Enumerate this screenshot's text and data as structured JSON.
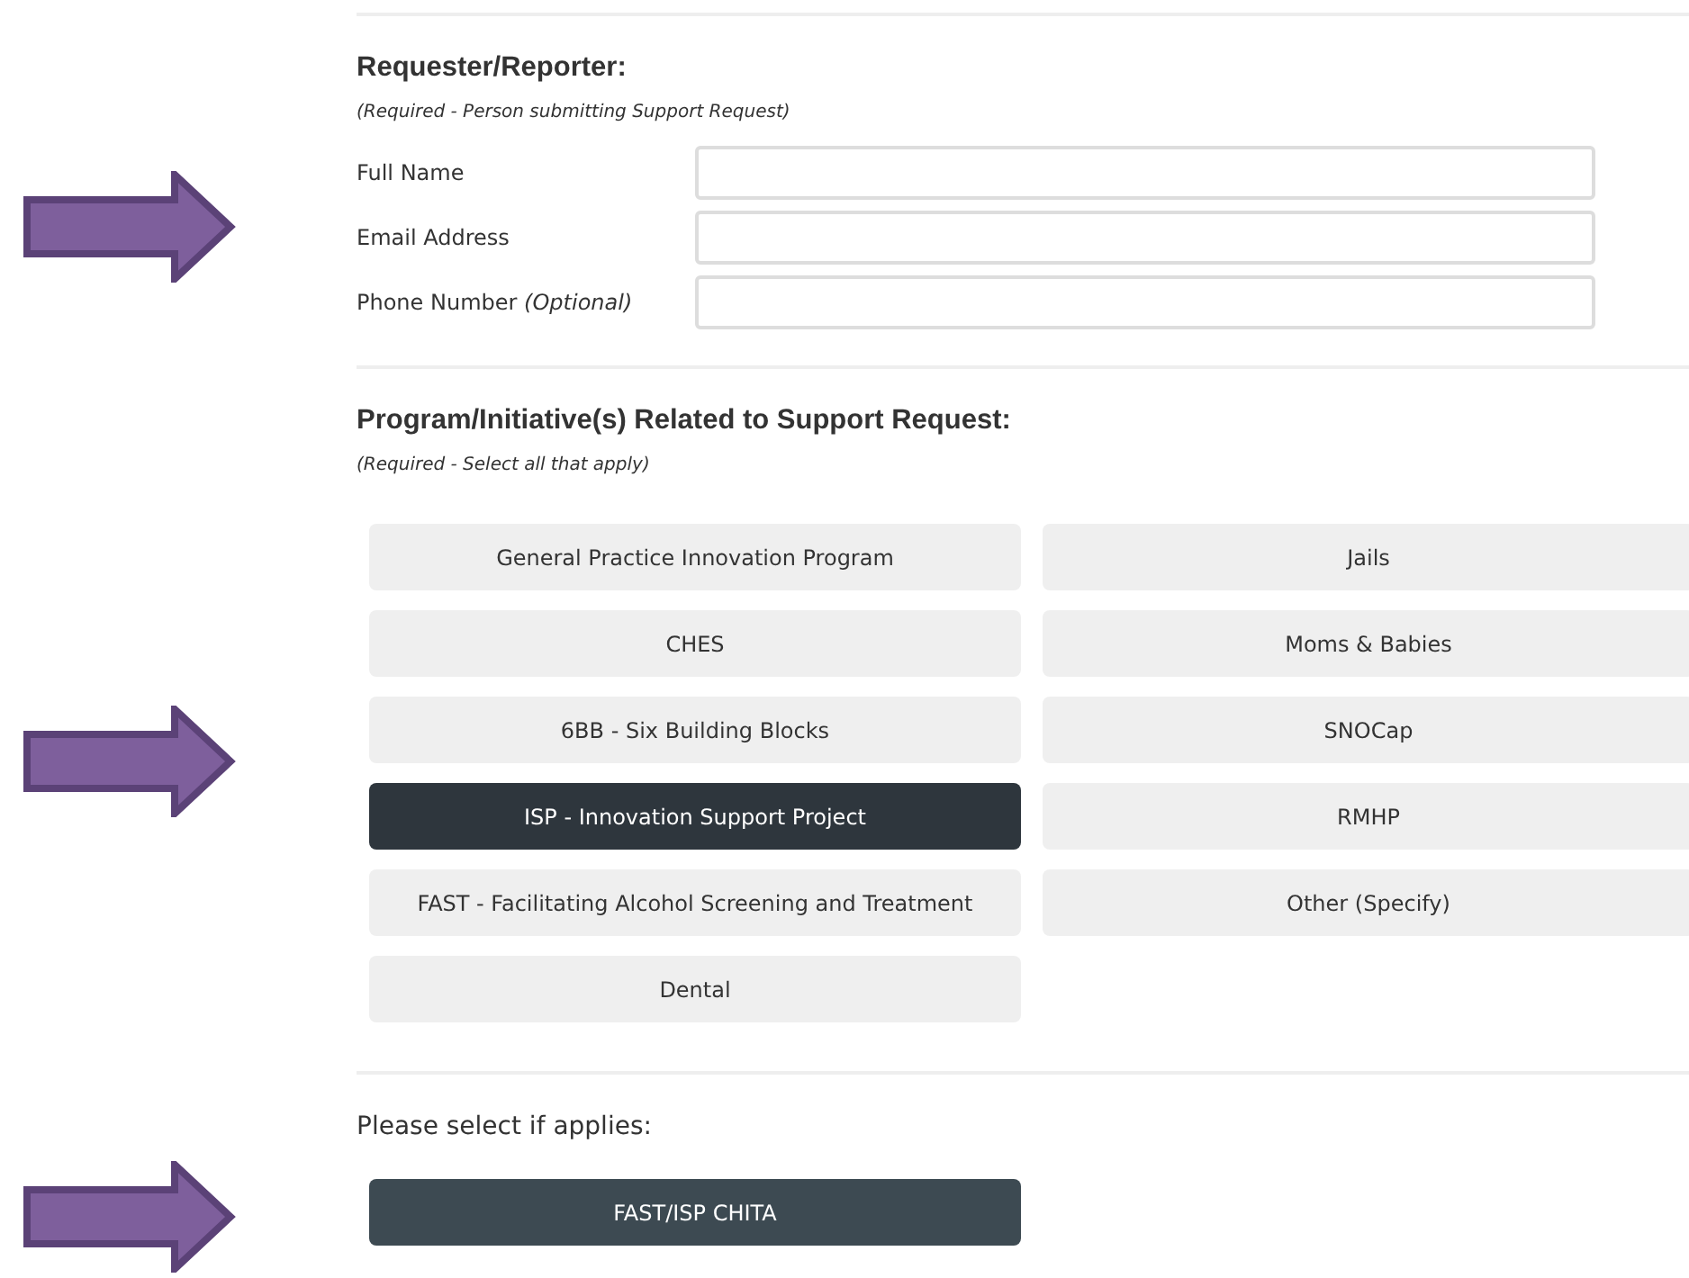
{
  "requester": {
    "heading": "Requester/Reporter:",
    "note": "(Required - Person submitting Support Request)",
    "fields": [
      {
        "label": "Full Name"
      },
      {
        "label": "Email Address"
      },
      {
        "label": "Phone Number",
        "hint": "(Optional)"
      }
    ]
  },
  "programs": {
    "heading": "Program/Initiative(s) Related to Support Request:",
    "note": "(Required - Select all that apply)",
    "options": [
      {
        "label": "General Practice Innovation Program",
        "selected": false
      },
      {
        "label": "Jails",
        "selected": false
      },
      {
        "label": "CHES",
        "selected": false
      },
      {
        "label": "Moms & Babies",
        "selected": false
      },
      {
        "label": "6BB - Six Building Blocks",
        "selected": false
      },
      {
        "label": "SNOCap",
        "selected": false
      },
      {
        "label": "ISP - Innovation Support Project",
        "selected": true
      },
      {
        "label": "RMHP",
        "selected": false
      },
      {
        "label": "FAST - Facilitating Alcohol Screening and Treatment",
        "selected": false
      },
      {
        "label": "Other (Specify)",
        "selected": false
      },
      {
        "label": "Dental",
        "selected": false
      }
    ]
  },
  "applies": {
    "prompt": "Please select if applies:",
    "options": [
      {
        "label": "FAST/ISP CHITA",
        "selected": true
      }
    ]
  }
}
